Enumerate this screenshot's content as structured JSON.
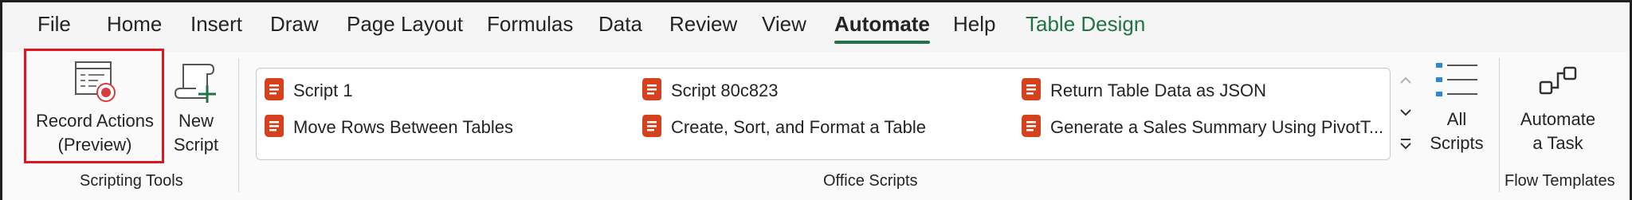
{
  "tabs": [
    {
      "label": "File"
    },
    {
      "label": "Home"
    },
    {
      "label": "Insert"
    },
    {
      "label": "Draw"
    },
    {
      "label": "Page Layout"
    },
    {
      "label": "Formulas"
    },
    {
      "label": "Data"
    },
    {
      "label": "Review"
    },
    {
      "label": "View"
    },
    {
      "label": "Automate",
      "active": true
    },
    {
      "label": "Help"
    },
    {
      "label": "Table Design",
      "contextual": true
    }
  ],
  "scripting_tools": {
    "group_label": "Scripting Tools",
    "record_actions": {
      "line1": "Record Actions",
      "line2": "(Preview)",
      "icon": "record-actions-icon"
    },
    "new_script": {
      "line1": "New",
      "line2": "Script",
      "icon": "new-script-icon"
    }
  },
  "office_scripts": {
    "group_label": "Office Scripts",
    "scripts": [
      {
        "label": "Script 1"
      },
      {
        "label": "Move Rows Between Tables"
      },
      {
        "label": "Script 80c823"
      },
      {
        "label": "Create, Sort, and Format a Table"
      },
      {
        "label": "Return Table Data as JSON"
      },
      {
        "label": "Generate a Sales Summary Using PivotT..."
      }
    ],
    "all_scripts": {
      "line1": "All",
      "line2": "Scripts",
      "icon": "all-scripts-icon"
    }
  },
  "flow_templates": {
    "group_label": "Flow Templates",
    "automate_task": {
      "line1": "Automate",
      "line2": "a Task",
      "icon": "automate-task-icon"
    }
  },
  "colors": {
    "accent": "#217346",
    "script_icon": "#d4411c",
    "highlight": "#e0161f"
  }
}
